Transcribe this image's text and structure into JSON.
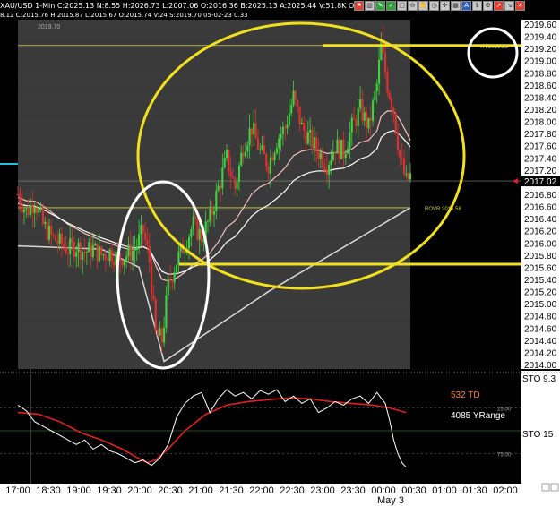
{
  "header": {
    "line1": "XAU/USD 1-Min C:2025.13 N:8.55 H:2026.73 L:2007.06 O:2016.36 B:2025.13 A:2025.44 V:51.8K OI:0",
    "line2": "8.12 C:2015.76 H:2015.87 L:2015.67 O:2015.74 V:24 S:2019.70 05-02-23 0.33",
    "toolbar_icons": [
      "flag-icon",
      "bar-chart-icon",
      "pencil-icon",
      "check-icon",
      "square-icon",
      "zoom-out-icon",
      "hand-icon",
      "clock-icon",
      "crosshair-icon",
      "grid-icon",
      "text-icon",
      "dollar-icon",
      "settings-icon",
      "chart-up-icon",
      "chart-down-icon",
      "close-icon"
    ]
  },
  "colors": {
    "plot_bg": "#3a3a3a",
    "bull": "#3fd43f",
    "bear": "#e03030",
    "annotation": "#f0e020",
    "ma_fast": "#f5c0c0",
    "ma_mid": "#ffffff",
    "ma_slow": "#d8d8d8",
    "stoch_fast": "#ffffff",
    "stoch_slow": "#e02020",
    "level_line": "#d8d040",
    "cyan_marker": "#20c0e0"
  },
  "chart_data": [
    {
      "type": "candlestick",
      "symbol": "XAU/USD",
      "interval": "1-Min",
      "ylim": [
        2014.0,
        2019.6
      ],
      "y_ticks": [
        2019.6,
        2019.4,
        2019.2,
        2019.0,
        2018.8,
        2018.6,
        2018.4,
        2018.2,
        2018.0,
        2017.8,
        2017.6,
        2017.4,
        2017.2,
        2017.02,
        2016.8,
        2016.6,
        2016.4,
        2016.2,
        2016.0,
        2015.8,
        2015.6,
        2015.4,
        2015.2,
        2015.0,
        2014.8,
        2014.6,
        2014.4,
        2014.2,
        2014.0
      ],
      "y_tick_labels": [
        "2019.60",
        "2019.40",
        "2019.20",
        "2019.00",
        "2018.80",
        "2018.60",
        "2018.40",
        "2018.20",
        "2018.00",
        "2017.80",
        "2017.60",
        "2017.40",
        "2017.20",
        "2017.02",
        "2016.80",
        "2016.60",
        "2016.40",
        "2016.20",
        "2016.00",
        "2015.80",
        "2015.60",
        "2015.40",
        "2015.20",
        "2015.00",
        "2014.80",
        "2014.60",
        "2014.40",
        "2014.20",
        "2014.00"
      ],
      "current_price": 2017.02,
      "current_price_label": "2017.02",
      "x_tick_labels": [
        "17:00",
        "18:30",
        "19:00",
        "19:30",
        "20:00",
        "20:30",
        "21:00",
        "21:30",
        "22:00",
        "22:30",
        "23:00",
        "23:30",
        "00:00",
        "00:30",
        "01:00",
        "01:30",
        "02:00"
      ],
      "date_label": "May 3",
      "top_label": "2019.70",
      "level_lines": [
        {
          "value": 2019.25,
          "label": "YH 2019.25"
        },
        {
          "value": 2016.58,
          "label": "ROVR 2016.58"
        }
      ],
      "price_path": [
        [
          0,
          2016.8
        ],
        [
          4,
          2016.5
        ],
        [
          8,
          2016.7
        ],
        [
          12,
          2016.3
        ],
        [
          16,
          2016.1
        ],
        [
          20,
          2016.0
        ],
        [
          24,
          2015.9
        ],
        [
          28,
          2015.95
        ],
        [
          32,
          2015.85
        ],
        [
          36,
          2015.9
        ],
        [
          40,
          2015.8
        ],
        [
          44,
          2015.85
        ],
        [
          48,
          2015.75
        ],
        [
          52,
          2015.8
        ],
        [
          56,
          2015.9
        ],
        [
          60,
          2016.2
        ],
        [
          63,
          2015.7
        ],
        [
          66,
          2014.5
        ],
        [
          69,
          2014.4
        ],
        [
          72,
          2015.3
        ],
        [
          76,
          2015.7
        ],
        [
          80,
          2016.0
        ],
        [
          84,
          2016.3
        ],
        [
          88,
          2016.1
        ],
        [
          92,
          2016.4
        ],
        [
          96,
          2016.9
        ],
        [
          100,
          2017.4
        ],
        [
          104,
          2016.9
        ],
        [
          108,
          2017.6
        ],
        [
          112,
          2017.9
        ],
        [
          116,
          2017.5
        ],
        [
          120,
          2017.3
        ],
        [
          124,
          2017.7
        ],
        [
          128,
          2017.9
        ],
        [
          132,
          2018.4
        ],
        [
          136,
          2017.9
        ],
        [
          140,
          2017.7
        ],
        [
          144,
          2017.5
        ],
        [
          148,
          2017.3
        ],
        [
          152,
          2017.6
        ],
        [
          156,
          2017.5
        ],
        [
          160,
          2017.9
        ],
        [
          164,
          2018.2
        ],
        [
          168,
          2017.9
        ],
        [
          172,
          2018.6
        ],
        [
          174,
          2019.25
        ],
        [
          177,
          2018.6
        ],
        [
          180,
          2018.2
        ],
        [
          183,
          2017.4
        ],
        [
          186,
          2017.0
        ],
        [
          188,
          2017.1
        ]
      ]
    },
    {
      "type": "line",
      "name": "STO",
      "ylim": [
        0,
        100
      ],
      "y_tick_labels": [
        "STO",
        "25.00",
        "STO",
        "75.00"
      ],
      "right_labels": [
        "STO 9.3",
        "STO 15"
      ],
      "side_text": [
        "532 TD",
        "4085 YRange"
      ],
      "fast_path": [
        [
          0,
          78
        ],
        [
          4,
          72
        ],
        [
          8,
          60
        ],
        [
          12,
          55
        ],
        [
          16,
          50
        ],
        [
          20,
          45
        ],
        [
          24,
          40
        ],
        [
          28,
          35
        ],
        [
          32,
          40
        ],
        [
          36,
          30
        ],
        [
          40,
          35
        ],
        [
          44,
          28
        ],
        [
          48,
          25
        ],
        [
          52,
          20
        ],
        [
          56,
          15
        ],
        [
          60,
          18
        ],
        [
          64,
          12
        ],
        [
          68,
          20
        ],
        [
          72,
          35
        ],
        [
          76,
          65
        ],
        [
          80,
          80
        ],
        [
          84,
          88
        ],
        [
          88,
          92
        ],
        [
          92,
          70
        ],
        [
          96,
          85
        ],
        [
          100,
          95
        ],
        [
          104,
          88
        ],
        [
          108,
          92
        ],
        [
          112,
          85
        ],
        [
          116,
          94
        ],
        [
          120,
          90
        ],
        [
          124,
          95
        ],
        [
          128,
          82
        ],
        [
          132,
          88
        ],
        [
          136,
          80
        ],
        [
          140,
          85
        ],
        [
          144,
          70
        ],
        [
          148,
          75
        ],
        [
          152,
          82
        ],
        [
          156,
          78
        ],
        [
          160,
          85
        ],
        [
          164,
          88
        ],
        [
          168,
          80
        ],
        [
          172,
          92
        ],
        [
          176,
          80
        ],
        [
          178,
          62
        ],
        [
          180,
          40
        ],
        [
          182,
          25
        ],
        [
          184,
          15
        ],
        [
          186,
          10
        ]
      ],
      "slow_path": [
        [
          0,
          70
        ],
        [
          10,
          68
        ],
        [
          20,
          60
        ],
        [
          30,
          48
        ],
        [
          40,
          40
        ],
        [
          50,
          30
        ],
        [
          56,
          22
        ],
        [
          62,
          15
        ],
        [
          66,
          18
        ],
        [
          72,
          30
        ],
        [
          80,
          50
        ],
        [
          90,
          68
        ],
        [
          100,
          78
        ],
        [
          110,
          82
        ],
        [
          120,
          84
        ],
        [
          130,
          86
        ],
        [
          140,
          85
        ],
        [
          150,
          82
        ],
        [
          160,
          80
        ],
        [
          170,
          78
        ],
        [
          178,
          75
        ],
        [
          186,
          70
        ]
      ]
    }
  ],
  "annotations": [
    "white-ellipse-left",
    "yellow-ellipse-main",
    "white-circle-yh",
    "yellow-line-yh",
    "yellow-line-support"
  ]
}
